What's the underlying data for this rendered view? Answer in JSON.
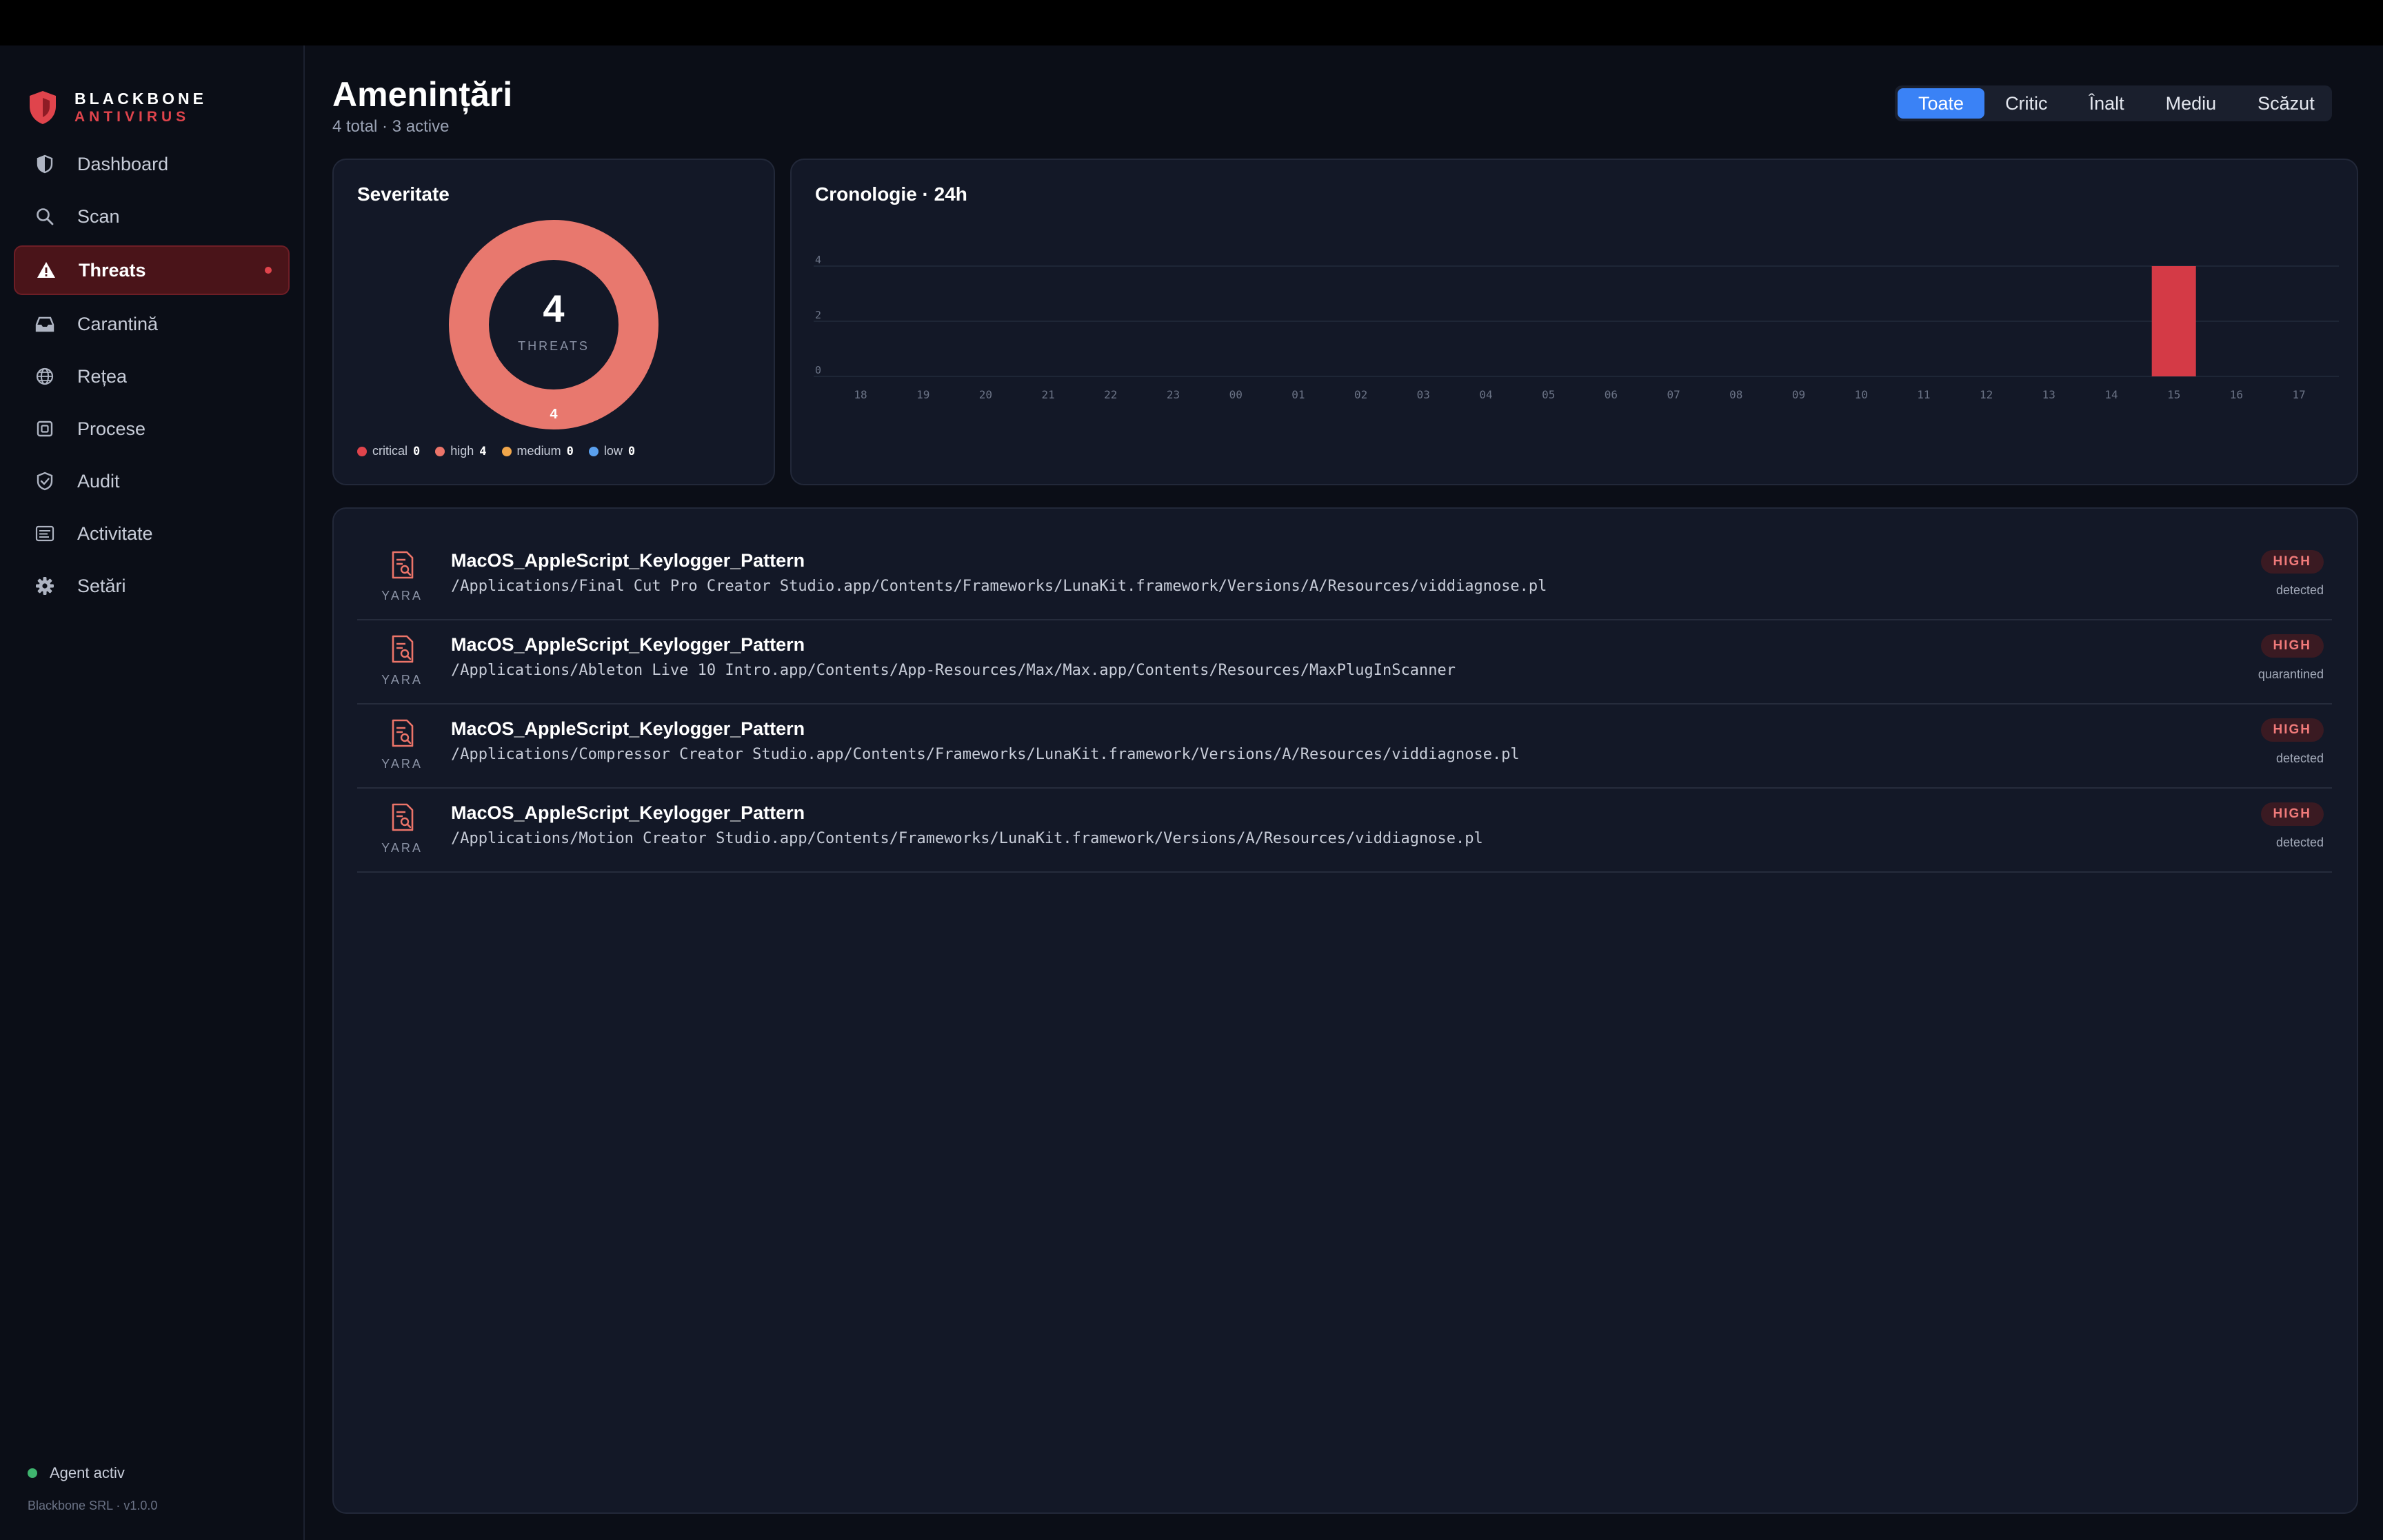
{
  "brand": {
    "name": "BLACKBONE",
    "sub": "ANTIVIRUS"
  },
  "sidebar": {
    "items": [
      {
        "label": "Dashboard",
        "icon": "shield-icon"
      },
      {
        "label": "Scan",
        "icon": "search-icon"
      },
      {
        "label": "Threats",
        "icon": "warning-icon",
        "active": true
      },
      {
        "label": "Carantină",
        "icon": "inbox-icon"
      },
      {
        "label": "Rețea",
        "icon": "globe-icon"
      },
      {
        "label": "Procese",
        "icon": "cpu-icon"
      },
      {
        "label": "Audit",
        "icon": "shield-check-icon"
      },
      {
        "label": "Activitate",
        "icon": "list-icon"
      },
      {
        "label": "Setări",
        "icon": "gear-icon"
      }
    ],
    "agent_label": "Agent activ",
    "footer": "Blackbone SRL · v1.0.0"
  },
  "header": {
    "title": "Amenințări",
    "subtitle": "4 total · 3 active"
  },
  "filters": [
    "Toate",
    "Critic",
    "Înalt",
    "Mediu",
    "Scăzut"
  ],
  "severity": {
    "title": "Severitate",
    "total": "4",
    "total_label": "THREATS",
    "segment_label": "4",
    "legend": [
      {
        "label": "critical",
        "count": "0",
        "color": "#e0444c"
      },
      {
        "label": "high",
        "count": "4",
        "color": "#ec7469"
      },
      {
        "label": "medium",
        "count": "0",
        "color": "#f0a64b"
      },
      {
        "label": "low",
        "count": "0",
        "color": "#5aa0ee"
      }
    ],
    "ring_color": "#e8786e"
  },
  "timeline": {
    "title": "Cronologie · 24h"
  },
  "chart_data": {
    "type": "bar",
    "title": "Cronologie · 24h",
    "categories": [
      "18",
      "19",
      "20",
      "21",
      "22",
      "23",
      "00",
      "01",
      "02",
      "03",
      "04",
      "05",
      "06",
      "07",
      "08",
      "09",
      "10",
      "11",
      "12",
      "13",
      "14",
      "15",
      "16",
      "17"
    ],
    "values": [
      0,
      0,
      0,
      0,
      0,
      0,
      0,
      0,
      0,
      0,
      0,
      0,
      0,
      0,
      0,
      0,
      0,
      0,
      0,
      0,
      0,
      4,
      0,
      0
    ],
    "yticks": [
      "0",
      "2",
      "4"
    ],
    "ylim": [
      0,
      4
    ],
    "grid": true,
    "bar_color": "#d43a46"
  },
  "threats": [
    {
      "name": "MacOS_AppleScript_Keylogger_Pattern",
      "path": "/Applications/Final Cut Pro Creator Studio.app/Contents/Frameworks/LunaKit.framework/Versions/A/Resources/viddiagnose.pl",
      "source": "YARA",
      "severity": "HIGH",
      "status": "detected"
    },
    {
      "name": "MacOS_AppleScript_Keylogger_Pattern",
      "path": "/Applications/Ableton Live 10 Intro.app/Contents/App-Resources/Max/Max.app/Contents/Resources/MaxPlugInScanner",
      "source": "YARA",
      "severity": "HIGH",
      "status": "quarantined"
    },
    {
      "name": "MacOS_AppleScript_Keylogger_Pattern",
      "path": "/Applications/Compressor Creator Studio.app/Contents/Frameworks/LunaKit.framework/Versions/A/Resources/viddiagnose.pl",
      "source": "YARA",
      "severity": "HIGH",
      "status": "detected"
    },
    {
      "name": "MacOS_AppleScript_Keylogger_Pattern",
      "path": "/Applications/Motion Creator Studio.app/Contents/Frameworks/LunaKit.framework/Versions/A/Resources/viddiagnose.pl",
      "source": "YARA",
      "severity": "HIGH",
      "status": "detected"
    }
  ]
}
